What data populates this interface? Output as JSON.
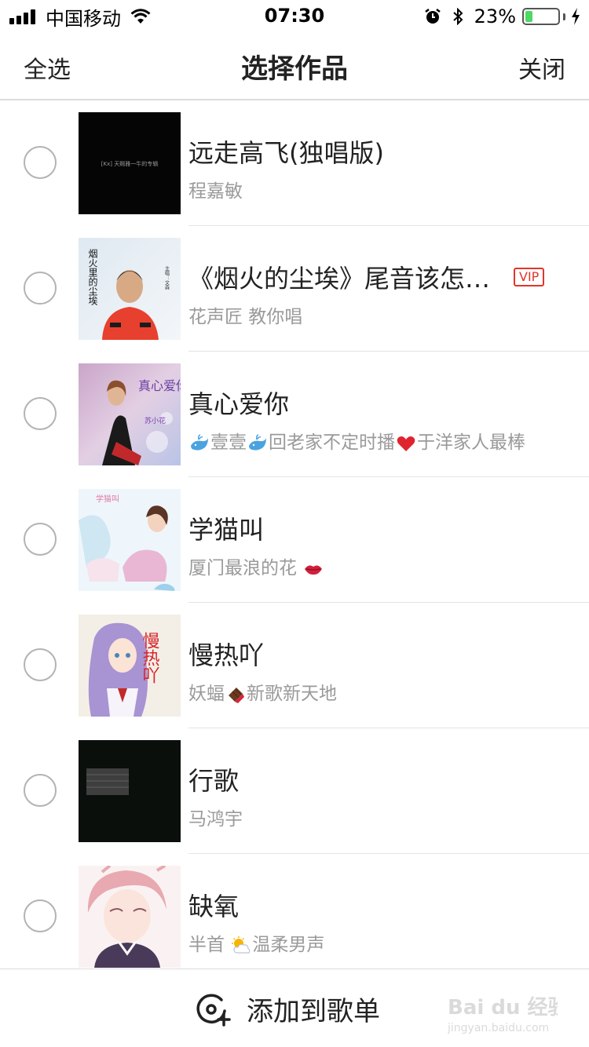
{
  "status_bar": {
    "carrier": "中国移动",
    "time": "07:30",
    "battery": "23%",
    "battery_level": 0.23
  },
  "header": {
    "select_all": "全选",
    "title": "选择作品",
    "close": "关闭"
  },
  "songs": [
    {
      "title": "远走高飞(独唱版)",
      "artist": "程嘉敏",
      "cover_label": "[Kx] 天赐雅一牛的专辑"
    },
    {
      "title": "《烟火的尘埃》尾音该怎…",
      "artist": "花声匠 教你唱",
      "badge": "VIP",
      "cover_label": "烟火里的尘埃",
      "cover_sub": "主唱：文森"
    },
    {
      "title": "真心爱你",
      "artist_parts": [
        "壹壹",
        "回老家不定时播",
        "于洋家人最棒"
      ],
      "cover_label": "真心爱你",
      "cover_sub": "苏小花"
    },
    {
      "title": "学猫叫",
      "artist": "厦门最浪的花",
      "cover_label": "学猫叫"
    },
    {
      "title": "慢热吖",
      "artist_parts": [
        "妖蝠",
        "新歌新天地"
      ],
      "cover_label": "慢热吖"
    },
    {
      "title": "行歌",
      "artist": "马鸿宇"
    },
    {
      "title": "缺氧",
      "artist_parts": [
        "半首",
        "温柔男声"
      ]
    }
  ],
  "footer": {
    "add_label": "添加到歌单"
  },
  "watermark": {
    "brand": "Bai du 经验",
    "url": "jingyan.baidu.com"
  },
  "colors": {
    "vip": "#e0362c",
    "radio_border": "#b3b3b3",
    "subtext": "#9a9a9a",
    "battery": "#4cd964"
  },
  "icons": [
    "signal-icon",
    "wifi-icon",
    "alarm-icon",
    "bluetooth-icon",
    "battery-icon",
    "charging-icon",
    "add-to-playlist-icon",
    "whale-emoji-icon",
    "heart-emoji-icon",
    "lips-emoji-icon",
    "chocolate-emoji-icon",
    "sun-cloud-emoji-icon"
  ]
}
